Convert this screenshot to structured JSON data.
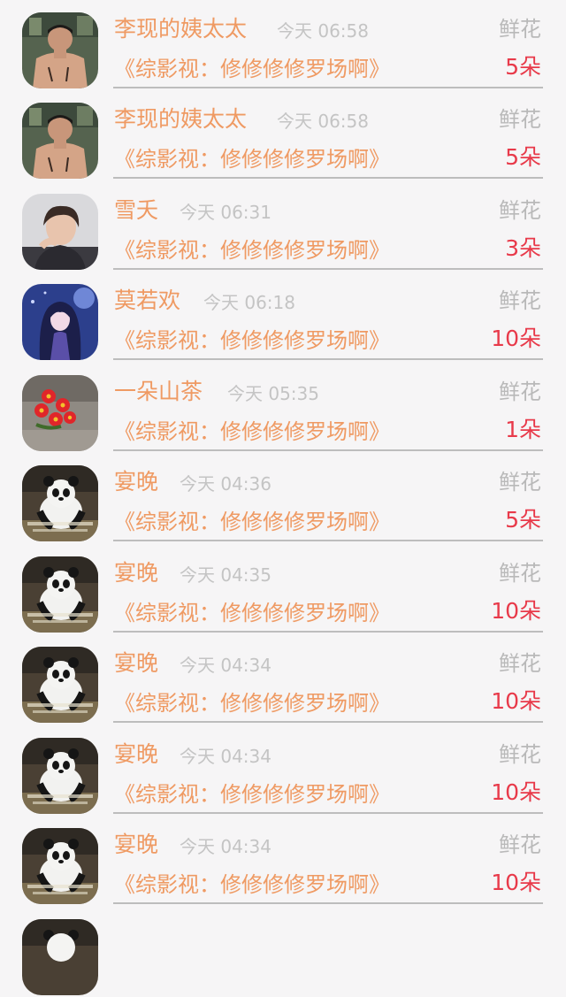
{
  "gift_label": "鲜花",
  "avatar_icons": [
    "shirtless-man-avatar-icon",
    "young-man-portrait-avatar-icon",
    "anime-girl-avatar-icon",
    "red-flowers-avatar-icon",
    "panda-meme-avatar-icon"
  ],
  "rows": [
    {
      "name": "李现的姨太太",
      "time": "今天 06:58",
      "book": "《综影视：修修修修罗场啊》",
      "count": "5朵",
      "avatar": "shirtless-man-avatar-icon"
    },
    {
      "name": "李现的姨太太",
      "time": "今天 06:58",
      "book": "《综影视：修修修修罗场啊》",
      "count": "5朵",
      "avatar": "shirtless-man-avatar-icon"
    },
    {
      "name": "雪夭",
      "time": "今天 06:31",
      "book": "《综影视：修修修修罗场啊》",
      "count": "3朵",
      "avatar": "young-man-portrait-avatar-icon"
    },
    {
      "name": "莫若欢",
      "time": "今天 06:18",
      "book": "《综影视：修修修修罗场啊》",
      "count": "10朵",
      "avatar": "anime-girl-avatar-icon"
    },
    {
      "name": "一朵山茶",
      "time": "今天 05:35",
      "book": "《综影视：修修修修罗场啊》",
      "count": "1朵",
      "avatar": "red-flowers-avatar-icon"
    },
    {
      "name": "宴晚",
      "time": "今天 04:36",
      "book": "《综影视：修修修修罗场啊》",
      "count": "5朵",
      "avatar": "panda-meme-avatar-icon"
    },
    {
      "name": "宴晚",
      "time": "今天 04:35",
      "book": "《综影视：修修修修罗场啊》",
      "count": "10朵",
      "avatar": "panda-meme-avatar-icon"
    },
    {
      "name": "宴晚",
      "time": "今天 04:34",
      "book": "《综影视：修修修修罗场啊》",
      "count": "10朵",
      "avatar": "panda-meme-avatar-icon"
    },
    {
      "name": "宴晚",
      "time": "今天 04:34",
      "book": "《综影视：修修修修罗场啊》",
      "count": "10朵",
      "avatar": "panda-meme-avatar-icon"
    },
    {
      "name": "宴晚",
      "time": "今天 04:34",
      "book": "《综影视：修修修修罗场啊》",
      "count": "10朵",
      "avatar": "panda-meme-avatar-icon"
    }
  ],
  "colors": {
    "background": "#f6f5f6",
    "name": "#ef9a63",
    "book": "#ef9a63",
    "time": "#c4c4c4",
    "gift": "#b9b9b9",
    "count": "#e83a4a",
    "divider": "#bdbdbd"
  }
}
